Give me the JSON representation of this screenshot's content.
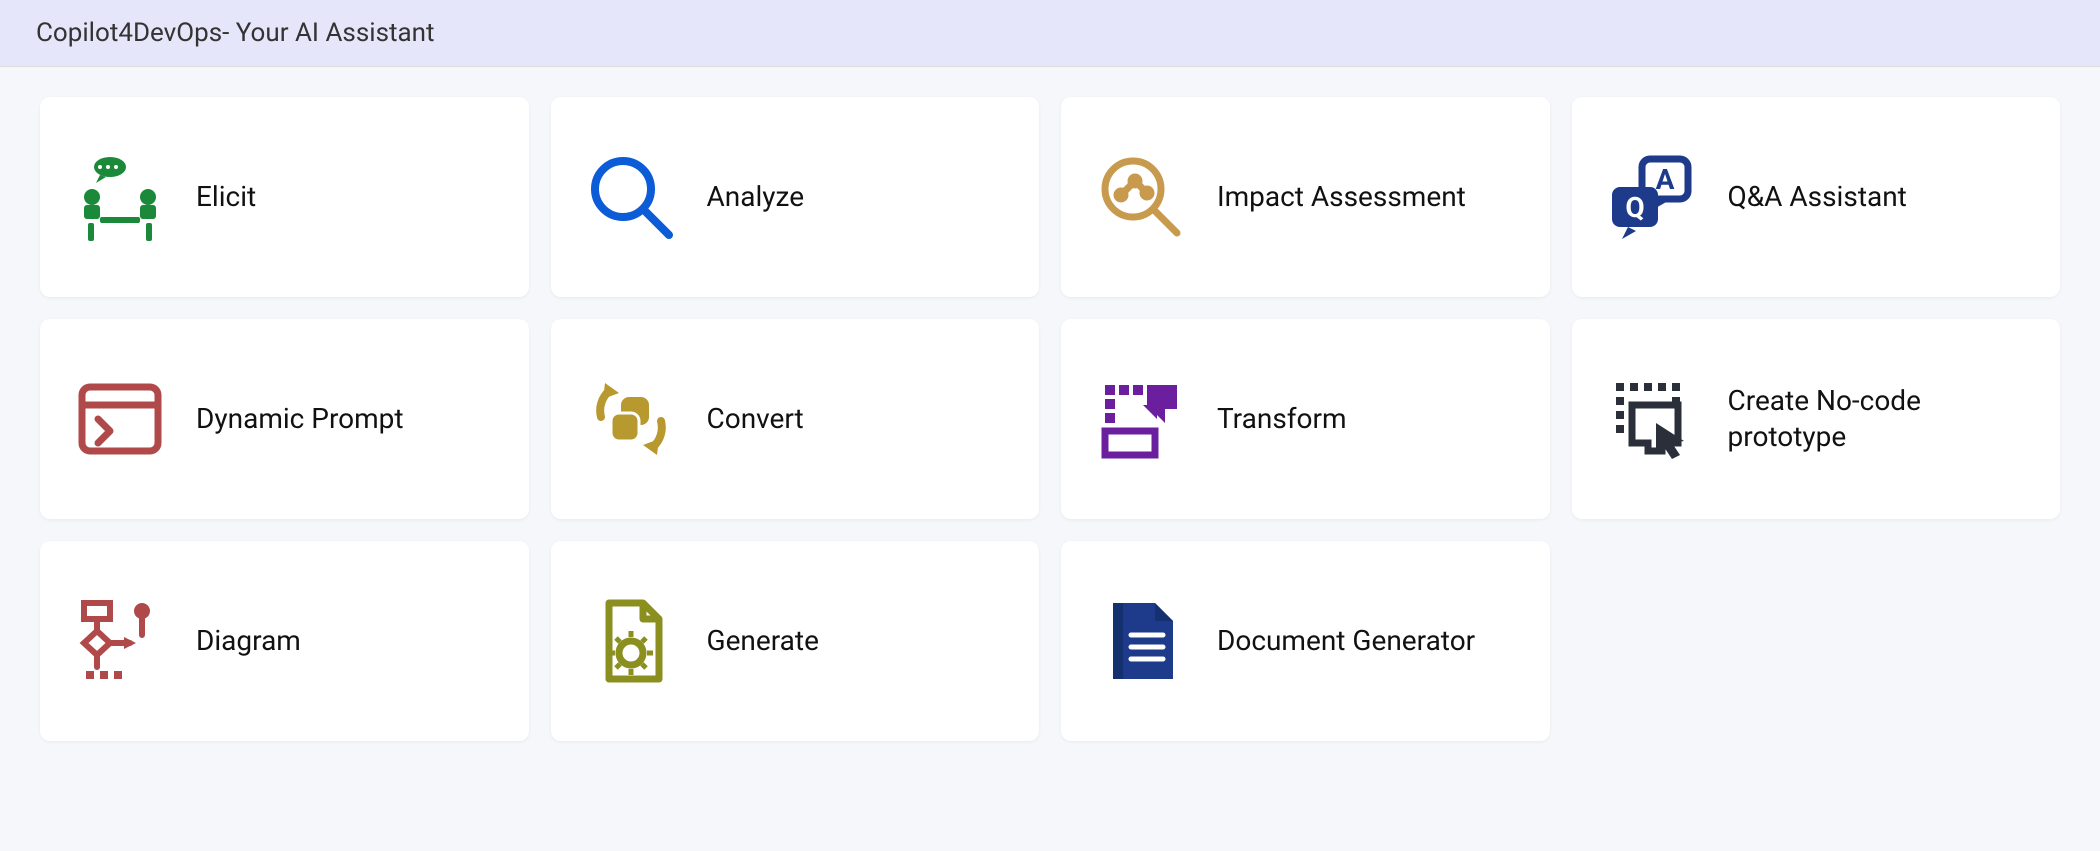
{
  "header": {
    "title": "Copilot4DevOps- Your AI Assistant"
  },
  "cards": [
    {
      "label": "Elicit",
      "icon": "elicit-icon"
    },
    {
      "label": "Analyze",
      "icon": "analyze-icon"
    },
    {
      "label": "Impact Assessment",
      "icon": "impact-icon"
    },
    {
      "label": "Q&A Assistant",
      "icon": "qa-icon"
    },
    {
      "label": "Dynamic Prompt",
      "icon": "prompt-icon"
    },
    {
      "label": "Convert",
      "icon": "convert-icon"
    },
    {
      "label": "Transform",
      "icon": "transform-icon"
    },
    {
      "label": "Create No-code prototype",
      "icon": "prototype-icon"
    },
    {
      "label": "Diagram",
      "icon": "diagram-icon"
    },
    {
      "label": "Generate",
      "icon": "generate-icon"
    },
    {
      "label": "Document Generator",
      "icon": "document-icon"
    }
  ],
  "colors": {
    "green": "#1a8a3a",
    "blue": "#0b5cd6",
    "tan": "#c79a4d",
    "navy": "#1e3a8a",
    "brick": "#b04a4a",
    "olive": "#b8992f",
    "purple": "#6b1f9e",
    "dark": "#2a2f3a"
  }
}
